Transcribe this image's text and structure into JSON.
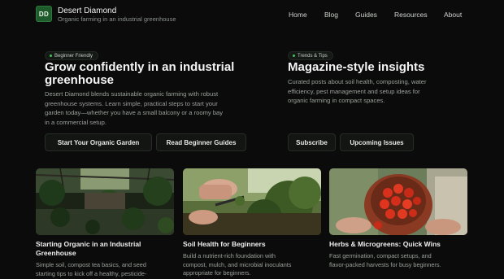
{
  "header": {
    "logo_text": "DD",
    "brand_name": "Desert Diamond",
    "tagline": "Organic farming in an industrial greenhouse",
    "nav": [
      "Home",
      "Blog",
      "Guides",
      "Resources",
      "About"
    ]
  },
  "hero_left": {
    "badge": "Beginner Friendly",
    "title_line1": "Grow confidently in an industrial",
    "title_line2": "greenhouse",
    "desc_lines": [
      "Desert Diamond blends sustainable organic farming with robust",
      "greenhouse systems. Learn simple, practical steps to start your",
      "garden today—whether you have a small balcony or a roomy bay",
      "in a commercial setup."
    ],
    "buttons": [
      "Start Your Organic Garden",
      "Read Beginner Guides"
    ]
  },
  "hero_right": {
    "badge": "Trends & Tips",
    "title": "Magazine-style insights",
    "desc_lines": [
      "Curated posts about soil health, composting, water",
      "efficiency, pest management and setup ideas for",
      "organic farming in compact spaces."
    ],
    "buttons": [
      "Subscribe",
      "Upcoming Issues"
    ]
  },
  "cards": [
    {
      "title_lines": [
        "Starting Organic in an Industrial",
        "Greenhouse"
      ],
      "text_lines": [
        "Simple soil, compost tea basics, and seed",
        "starting tips to kick off a healthy, pesticide-"
      ]
    },
    {
      "title_lines": [
        "Soil Health for Beginners"
      ],
      "text_lines": [
        "Build a nutrient-rich foundation with",
        "compost, mulch, and microbial inoculants",
        "appropriate for beginners."
      ]
    },
    {
      "title_lines": [
        "Herbs & Microgreens: Quick Wins"
      ],
      "text_lines": [
        "Fast germination, compact setups, and",
        "flavor-packed harvests for busy beginners."
      ]
    }
  ],
  "colors": {
    "background": "#0b0b0b",
    "accent_green": "#45c25a",
    "logo_bg": "#1f5a2c"
  }
}
